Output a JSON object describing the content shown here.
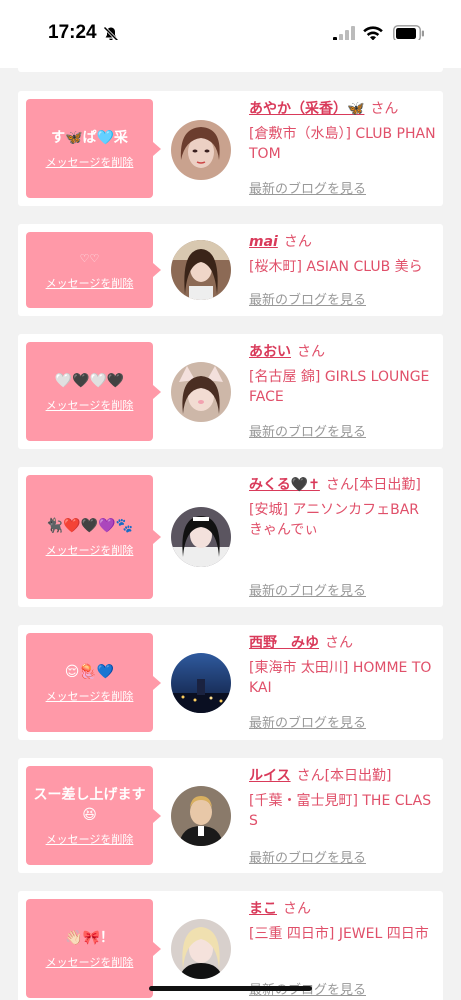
{
  "status": {
    "time": "17:24"
  },
  "common": {
    "delete_label": "メッセージを削除",
    "blog_label": "最新のブログを見る",
    "san": "さん"
  },
  "cards": [
    {
      "message": "す🦋ぱ🩵采",
      "name": "あやか（采香）🦋",
      "suffix": "",
      "shop": "[倉敷市（水島）] CLUB PHANTOM"
    },
    {
      "message": "♡♡",
      "name": "mai",
      "suffix": "",
      "shop": "[桜木町] ASIAN CLUB 美ら"
    },
    {
      "message": "🤍🖤🤍🖤",
      "name": "あおい",
      "suffix": "",
      "shop": "[名古屋 錦] GIRLS LOUNGE FACE"
    },
    {
      "message": "🐈‍⬛❤️🖤💜🐾",
      "name": "みくる🖤✝",
      "suffix": "[本日出勤]",
      "shop": "[安城] アニソンカフェBAR きゃんでぃ"
    },
    {
      "message": "😌🪼💙",
      "name": "西野　みゆ",
      "suffix": "",
      "shop": "[東海市 太田川] HOMME TOKAI"
    },
    {
      "message": "スー差し上げます😆",
      "name": "ルイス",
      "suffix": "[本日出勤]",
      "shop": "[千葉・富士見町] THE CLASS"
    },
    {
      "message": "👋🏻🎀！",
      "name": "まこ",
      "suffix": "",
      "shop": "[三重 四日市] JEWEL 四日市"
    }
  ]
}
